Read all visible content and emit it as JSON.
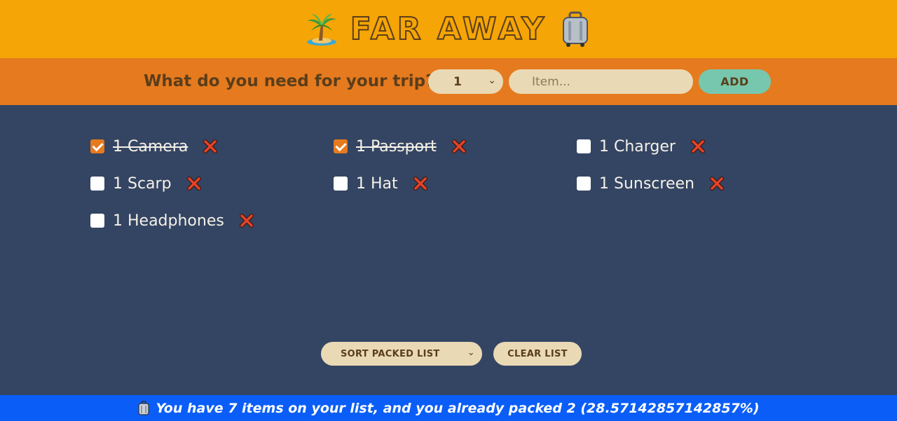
{
  "header": {
    "title": "FAR AWAY",
    "left_icon": "palm-island-icon",
    "right_icon": "luggage-icon"
  },
  "form": {
    "question": "What do you need for your trip?",
    "quantity_value": "1",
    "item_placeholder": "Item...",
    "add_label": "ADD"
  },
  "items": [
    {
      "label": "1 Camera",
      "packed": true
    },
    {
      "label": "1 Passport",
      "packed": true
    },
    {
      "label": "1 Charger",
      "packed": false
    },
    {
      "label": "1 Scarp",
      "packed": false
    },
    {
      "label": "1 Hat",
      "packed": false
    },
    {
      "label": "1 Sunscreen",
      "packed": false
    },
    {
      "label": "1 Headphones",
      "packed": false
    }
  ],
  "actions": {
    "sort_value": "SORT PACKED LIST",
    "clear_label": "CLEAR LIST"
  },
  "stats": {
    "text": "You have 7 items on your list, and you already packed 2 (28.57142857142857%)",
    "icon": "luggage-icon"
  },
  "colors": {
    "header_bg": "#f5a505",
    "form_bg": "#e67a1e",
    "list_bg": "#344563",
    "stats_bg": "#0a5ef7",
    "accent_green": "#76c7ad",
    "input_bg": "#ead9b5"
  }
}
